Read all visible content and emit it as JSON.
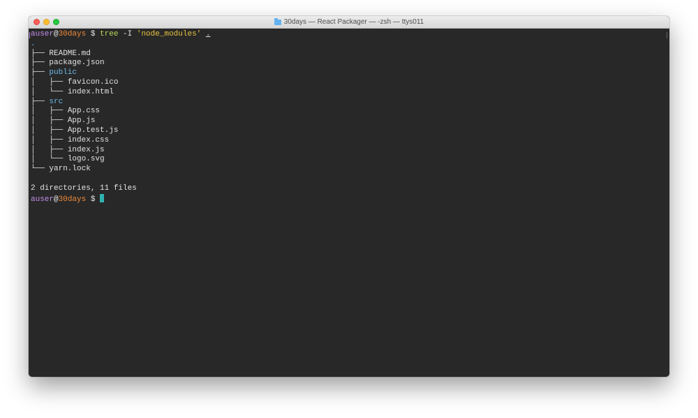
{
  "window": {
    "title": "30days — React Packager — -zsh — ttys011"
  },
  "terminal": {
    "prompt": {
      "user": "auser",
      "at": "@",
      "host": "30days",
      "symbol": " $ "
    },
    "command": {
      "name": "tree",
      "flag": " -I ",
      "pattern": "'node_modules'",
      "arg": "."
    },
    "tree_lines": [
      {
        "prefix": "",
        "name": ".",
        "type": "root"
      },
      {
        "prefix": "├── ",
        "name": "README.md",
        "type": "file"
      },
      {
        "prefix": "├── ",
        "name": "package.json",
        "type": "file"
      },
      {
        "prefix": "├── ",
        "name": "public",
        "type": "dir"
      },
      {
        "prefix": "│   ├── ",
        "name": "favicon.ico",
        "type": "file"
      },
      {
        "prefix": "│   └── ",
        "name": "index.html",
        "type": "file"
      },
      {
        "prefix": "├── ",
        "name": "src",
        "type": "dir"
      },
      {
        "prefix": "│   ├── ",
        "name": "App.css",
        "type": "file"
      },
      {
        "prefix": "│   ├── ",
        "name": "App.js",
        "type": "file"
      },
      {
        "prefix": "│   ├── ",
        "name": "App.test.js",
        "type": "file"
      },
      {
        "prefix": "│   ├── ",
        "name": "index.css",
        "type": "file"
      },
      {
        "prefix": "│   ├── ",
        "name": "index.js",
        "type": "file"
      },
      {
        "prefix": "│   └── ",
        "name": "logo.svg",
        "type": "file"
      },
      {
        "prefix": "└── ",
        "name": "yarn.lock",
        "type": "file"
      }
    ],
    "summary": "2 directories, 11 files"
  },
  "colors": {
    "terminal_bg": "#282828",
    "user": "#c38ee8",
    "host": "#f08a3a",
    "command": "#b8d85a",
    "string": "#e7c23e",
    "directory": "#6fb8e8",
    "cursor": "#2fb3b0"
  },
  "icons": {
    "title_folder": "folder-icon"
  }
}
